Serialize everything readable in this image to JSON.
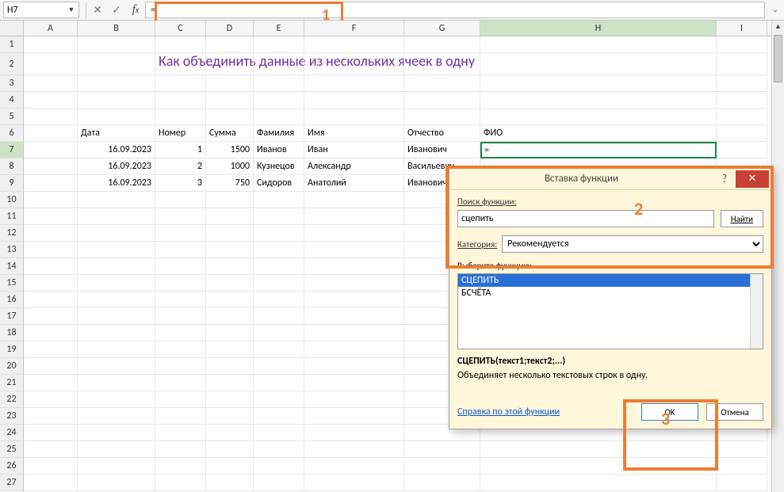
{
  "formula_bar": {
    "cell_ref": "H7",
    "formula": "=",
    "fx_label": "fx"
  },
  "annotations": {
    "n1": "1",
    "n2": "2",
    "n3": "3"
  },
  "columns": [
    "A",
    "B",
    "C",
    "D",
    "E",
    "F",
    "G",
    "H",
    "I"
  ],
  "row_numbers": [
    1,
    2,
    3,
    4,
    5,
    6,
    7,
    8,
    9,
    10,
    11,
    12,
    13,
    14,
    15,
    16,
    17,
    18,
    19,
    20,
    21,
    22,
    23,
    24,
    25,
    26,
    27
  ],
  "title": "Как объединить данные из нескольких ячеек в одну",
  "headers": {
    "B": "Дата",
    "C": "Номер",
    "D": "Сумма",
    "E": "Фамилия",
    "F": "Имя",
    "G": "Отчество",
    "H": "ФИО"
  },
  "rows": [
    {
      "B": "16.09.2023",
      "C": "1",
      "D": "1500",
      "E": "Иванов",
      "F": "Иван",
      "G": "Иванович",
      "H": "="
    },
    {
      "B": "16.09.2023",
      "C": "2",
      "D": "1000",
      "E": "Кузнецов",
      "F": "Александр",
      "G": "Васильевич",
      "H": ""
    },
    {
      "B": "16.09.2023",
      "C": "3",
      "D": "750",
      "E": "Сидоров",
      "F": "Анатолий",
      "G": "Иванович",
      "H": ""
    }
  ],
  "dialog": {
    "title": "Вставка функции",
    "search_label": "Поиск функции:",
    "search_value": "сцепить",
    "find_btn": "Найти",
    "category_label": "Категория:",
    "category_value": "Рекомендуется",
    "select_label": "Выберите функцию:",
    "functions": [
      "СЦЕПИТЬ",
      "БСЧЁТА"
    ],
    "selected_index": 0,
    "signature": "СЦЕПИТЬ(текст1;текст2;...)",
    "description": "Объединяет несколько текстовых строк в одну.",
    "help_link": "Справка по этой функции",
    "ok": "OK",
    "cancel": "Отмена"
  }
}
